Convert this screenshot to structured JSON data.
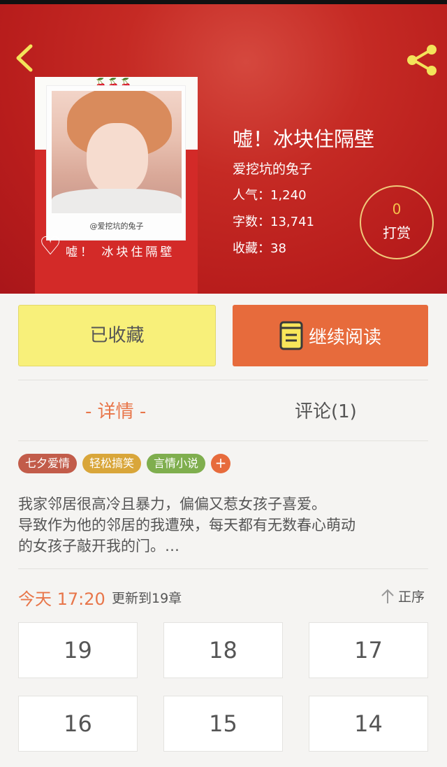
{
  "book": {
    "title": "嘘！冰块住隔壁",
    "author": "爱挖坑的兔子",
    "popularity": "人气：1,240",
    "word_count": "字数：13,741",
    "favorites": "收藏：38",
    "cover": {
      "cherries": "🍒🍒🍒",
      "watermark": "@爱挖坑的兔子",
      "title_text": "嘘！ 冰块住隔壁",
      "heart": "♡"
    }
  },
  "reward": {
    "count": "0",
    "label": "打赏"
  },
  "actions": {
    "favorited_label": "已收藏",
    "continue_reading_label": "继续阅读"
  },
  "tabs": [
    {
      "label": "- 详情 -",
      "active": true
    },
    {
      "label": "评论(1)",
      "active": false
    }
  ],
  "tags": [
    {
      "label": "七夕爱情",
      "color": "#c25c4a"
    },
    {
      "label": "轻松搞笑",
      "color": "#d9a63a"
    },
    {
      "label": "言情小说",
      "color": "#7fae4e"
    }
  ],
  "tag_add": "+",
  "summary": {
    "line1": "我家邻居很高冷且暴力，偏偏又惹女孩子喜爱。",
    "line2": "导致作为他的邻居的我遭殃，每天都有无数春心萌动",
    "line3": "的女孩子敲开我的门。…"
  },
  "update": {
    "today": "今天 17:20",
    "text": "更新到19章",
    "sort_label": "正序"
  },
  "chapters": [
    "19",
    "18",
    "17",
    "16",
    "15",
    "14"
  ],
  "colors": {
    "accent": "#e8764a",
    "hero_red": "#c52a24",
    "favorite_yellow": "#f8f07a",
    "read_orange": "#e76b3c"
  }
}
